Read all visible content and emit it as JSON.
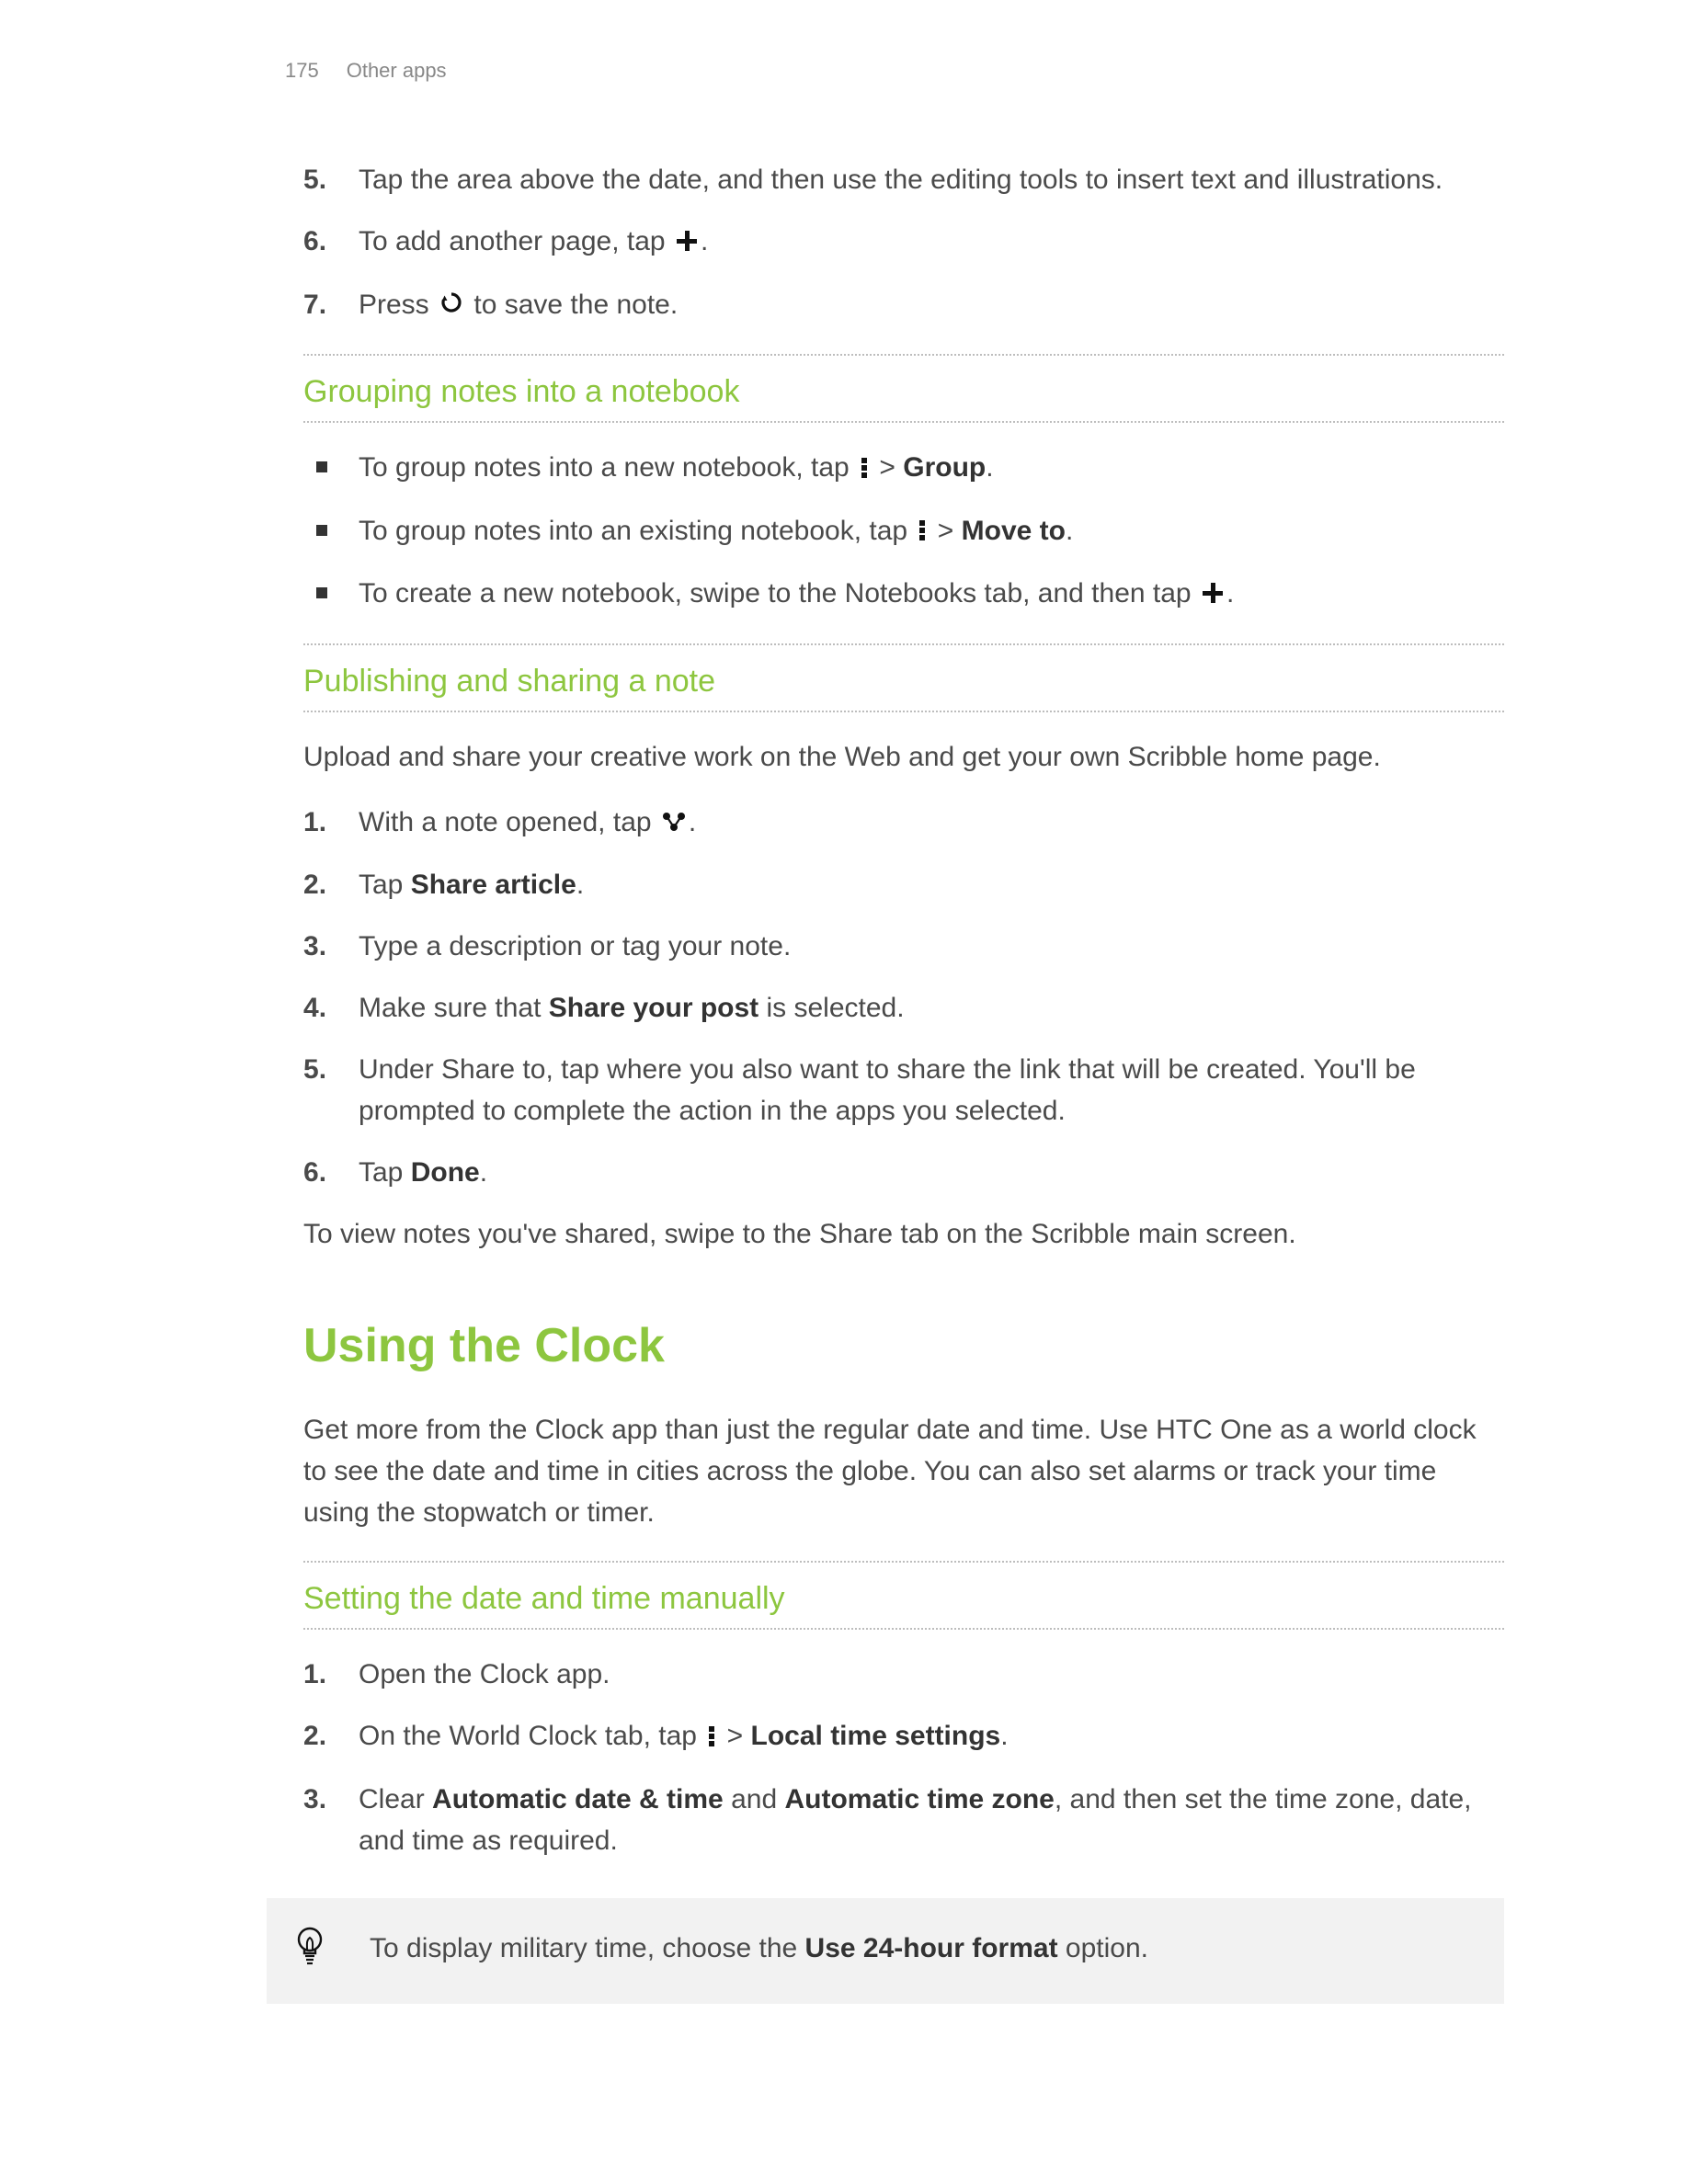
{
  "header": {
    "page_num": "175",
    "section": "Other apps"
  },
  "list1": {
    "item5": "Tap the area above the date, and then use the editing tools to insert text and illustrations.",
    "item6_a": "To add another page, tap ",
    "item6_b": ".",
    "item7_a": "Press ",
    "item7_b": " to save the note."
  },
  "sec1": {
    "title": "Grouping notes into a notebook",
    "b1_a": "To group notes into a new notebook, tap ",
    "b1_b": " > ",
    "b1_c": "Group",
    "b1_d": ".",
    "b2_a": "To group notes into an existing notebook, tap ",
    "b2_b": " > ",
    "b2_c": "Move to",
    "b2_d": ".",
    "b3_a": "To create a new notebook, swipe to the Notebooks tab, and then tap ",
    "b3_b": "."
  },
  "sec2": {
    "title": "Publishing and sharing a note",
    "intro": "Upload and share your creative work on the Web and get your own Scribble home page.",
    "s1_a": "With a note opened, tap ",
    "s1_b": ".",
    "s2_a": "Tap ",
    "s2_b": "Share article",
    "s2_c": ".",
    "s3": "Type a description or tag your note.",
    "s4_a": "Make sure that ",
    "s4_b": "Share your post",
    "s4_c": " is selected.",
    "s5": "Under Share to, tap where you also want to share the link that will be created. You'll be prompted to complete the action in the apps you selected.",
    "s6_a": "Tap ",
    "s6_b": "Done",
    "s6_c": ".",
    "outro": "To view notes you've shared, swipe to the Share tab on the Scribble main screen."
  },
  "sec3": {
    "title": "Using the Clock",
    "intro": "Get more from the Clock app than just the regular date and time. Use HTC One as a world clock to see the date and time in cities across the globe. You can also set alarms or track your time using the stopwatch or timer.",
    "sub": "Setting the date and time manually",
    "s1": "Open the Clock app.",
    "s2_a": "On the World Clock tab, tap ",
    "s2_b": " > ",
    "s2_c": "Local time settings",
    "s2_d": ".",
    "s3_a": "Clear ",
    "s3_b": "Automatic date & time",
    "s3_c": " and ",
    "s3_d": "Automatic time zone",
    "s3_e": ", and then set the time zone, date, and time as required.",
    "tip_a": "To display military time, choose the ",
    "tip_b": "Use 24-hour format",
    "tip_c": " option."
  }
}
